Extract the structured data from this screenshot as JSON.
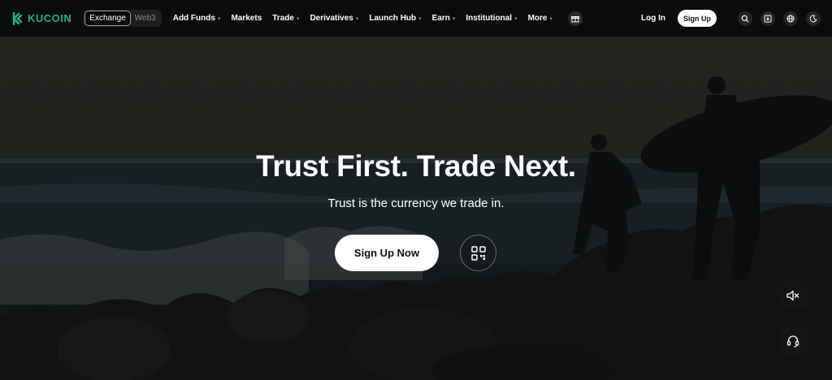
{
  "brand": {
    "name": "KUCOIN",
    "accent": "#24ae8f"
  },
  "nav": {
    "segment": {
      "exchange": "Exchange",
      "web3": "Web3"
    },
    "menu": [
      {
        "label": "Add Funds",
        "has_caret": true
      },
      {
        "label": "Markets",
        "has_caret": false
      },
      {
        "label": "Trade",
        "has_caret": true
      },
      {
        "label": "Derivatives",
        "has_caret": true
      },
      {
        "label": "Launch Hub",
        "has_caret": true
      },
      {
        "label": "Earn",
        "has_caret": true
      },
      {
        "label": "Institutional",
        "has_caret": true
      },
      {
        "label": "More",
        "has_caret": true
      }
    ],
    "login_label": "Log In",
    "signup_label": "Sign Up",
    "icons": [
      "gift-icon",
      "search-icon",
      "download-icon",
      "globe-icon",
      "theme-moon-icon"
    ]
  },
  "hero": {
    "title": "Trust First. Trade Next.",
    "subtitle": "Trust is the currency we trade in.",
    "cta_label": "Sign Up Now",
    "qr_icon": "qr-code-icon"
  },
  "side_buttons": [
    "sound-muted-icon",
    "support-headset-icon"
  ]
}
